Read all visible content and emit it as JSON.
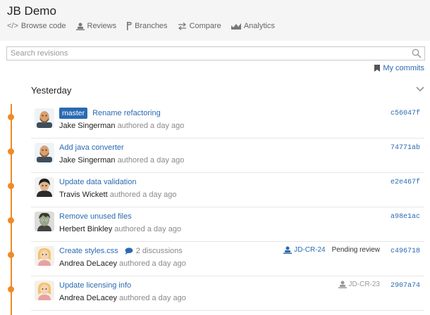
{
  "project": {
    "title": "JB Demo"
  },
  "nav": [
    {
      "label": "Browse code",
      "icon": "code-icon"
    },
    {
      "label": "Reviews",
      "icon": "reviews-icon"
    },
    {
      "label": "Branches",
      "icon": "branches-icon"
    },
    {
      "label": "Compare",
      "icon": "compare-icon"
    },
    {
      "label": "Analytics",
      "icon": "analytics-icon"
    }
  ],
  "search": {
    "placeholder": "Search revisions",
    "value": ""
  },
  "my_commits": {
    "label": "My commits"
  },
  "section": {
    "title": "Yesterday"
  },
  "commits": [
    {
      "branch": "master",
      "message": "Rename refactoring",
      "author": "Jake Singerman",
      "authored": "authored a day ago",
      "hash": "c56047f"
    },
    {
      "message": "Add java converter",
      "author": "Jake Singerman",
      "authored": "authored a day ago",
      "hash": "74771ab"
    },
    {
      "message": "Update data validation",
      "author": "Travis Wickett",
      "authored": "authored a day ago",
      "hash": "e2e467f"
    },
    {
      "message": "Remove unused files",
      "author": "Herbert Binkley",
      "authored": "authored a day ago",
      "hash": "a98e1ac"
    },
    {
      "message": "Create styles.css",
      "discussions": "2 discussions",
      "author": "Andrea DeLacey",
      "authored": "authored a day ago",
      "hash": "c496718",
      "review": "JD-CR-24",
      "review_status": "Pending review"
    },
    {
      "message": "Update licensing info",
      "author": "Andrea DeLacey",
      "authored": "authored a day ago",
      "hash": "2907a74",
      "review": "JD-CR-23"
    }
  ],
  "colors": {
    "accent": "#f08a24",
    "link": "#2a6ab2",
    "header_bg": "#f5f5f5"
  }
}
